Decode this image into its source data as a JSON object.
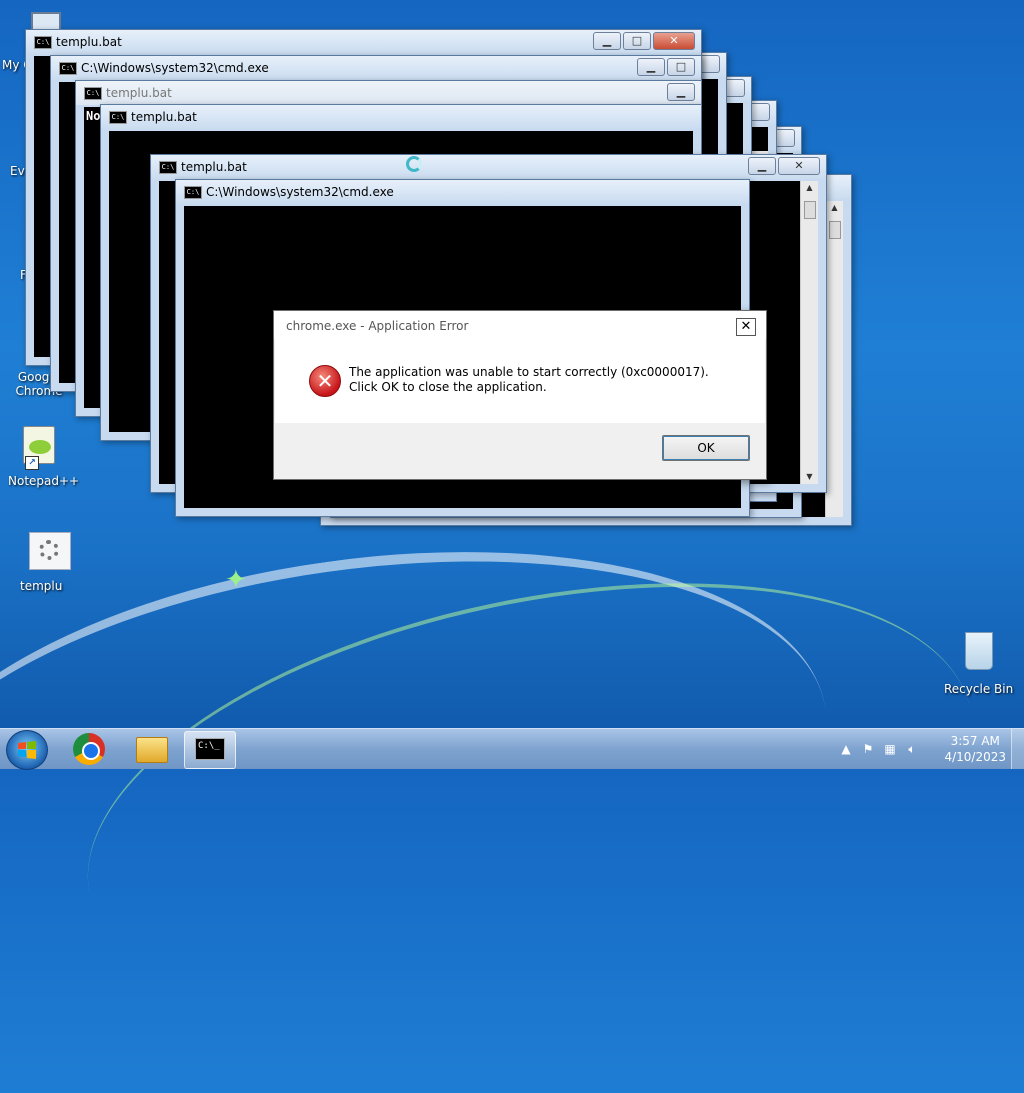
{
  "desktop": {
    "icons": [
      {
        "label": "My C",
        "name": "computer"
      },
      {
        "label": "Eve",
        "name": "everything"
      },
      {
        "label": "F",
        "name": "firefox"
      },
      {
        "label": "Google Chrome",
        "name": "chrome"
      },
      {
        "label": "Notepad++",
        "name": "notepadpp"
      },
      {
        "label": "templu",
        "name": "templu"
      },
      {
        "label": "Recycle Bin",
        "name": "recycle-bin"
      }
    ]
  },
  "windows": [
    {
      "title": "templu.bat"
    },
    {
      "title": "C:\\Windows\\system32\\cmd.exe"
    },
    {
      "title": "templu.bat",
      "body_text": "No"
    },
    {
      "title": "templu.bat"
    },
    {
      "title": "templu.bat"
    },
    {
      "title": "C:\\Windows\\system32\\cmd.exe"
    }
  ],
  "dialog": {
    "title": "chrome.exe - Application Error",
    "close_label": "✕",
    "message": "The application was unable to start correctly (0xc0000017). Click OK to close the application.",
    "ok_label": "OK"
  },
  "taskbar": {
    "clock_time": "3:57 AM",
    "clock_date": "4/10/2023",
    "cmd_label": "C:\\_"
  },
  "icons": {
    "error": "error-icon",
    "start": "windows-start-icon"
  },
  "colors": {
    "error_red": "#c7151a",
    "desktop_blue": "#1f7fd4"
  }
}
